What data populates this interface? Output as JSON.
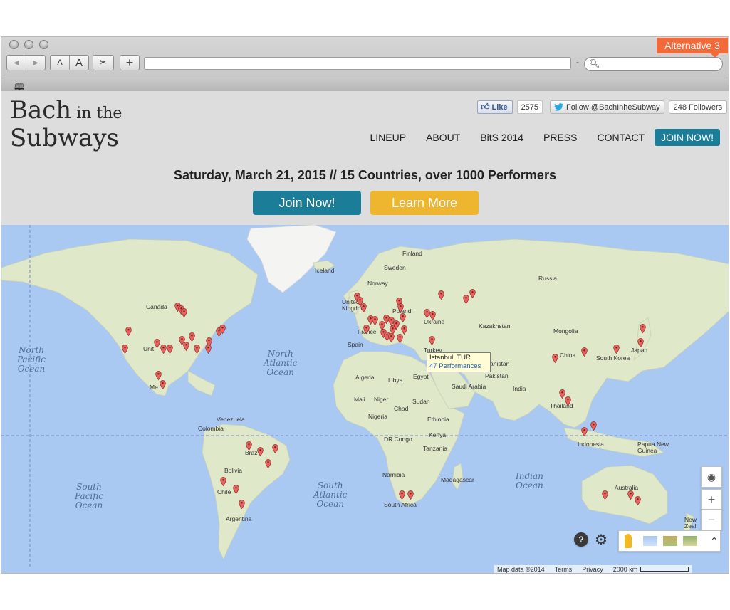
{
  "browser": {
    "nav_back": "◀",
    "nav_forward": "▶",
    "text_smaller": "A",
    "text_larger": "A",
    "scissors": "✂",
    "add_tab": "+",
    "url_separator": "-",
    "search_glyph": "🔍︎",
    "badge": "Alternative 3",
    "bookmarks_glyph": "🕮"
  },
  "site": {
    "logo_line1": "Bach",
    "logo_line1_small": " in the",
    "logo_line2": "Subways",
    "fb_like": "Like",
    "fb_count": "2575",
    "tw_follow": "Follow @BachInheSubway",
    "tw_count": "248 Followers",
    "nav": {
      "lineup": "LINEUP",
      "about": "ABOUT",
      "bits": "BitS 2014",
      "press": "PRESS",
      "contact": "CONTACT",
      "join": "JOIN NOW!"
    },
    "tagline": "Saturday, March 21, 2015 // 15 Countries, over 1000 Performers",
    "cta_join": "Join Now!",
    "cta_learn": "Learn More"
  },
  "map": {
    "oceans": {
      "north_pacific": "North\nPacific\nOcean",
      "north_atlantic": "North\nAtlantic\nOcean",
      "south_pacific": "South\nPacific\nOcean",
      "south_atlantic": "South\nAtlantic\nOcean",
      "indian": "Indian\nOcean"
    },
    "countries": {
      "finland": "Finland",
      "iceland": "Iceland",
      "sweden": "Sweden",
      "norway": "Norway",
      "russia": "Russia",
      "canada": "Canada",
      "united_kingdom": "United\nKingdom",
      "poland": "Poland",
      "ukraine": "Ukraine",
      "kazakhstan": "Kazakhstan",
      "mongolia": "Mongolia",
      "france": "France",
      "spain": "Spain",
      "turkey": "Turkey",
      "china": "China",
      "south_korea": "South Korea",
      "japan": "Japan",
      "united_states": "Unit",
      "algeria": "Algeria",
      "libya": "Libya",
      "egypt": "Egypt",
      "saudi_arabia": "Saudi Arabia",
      "pakistan": "Pakistan",
      "afghanistan": "anistan",
      "india": "India",
      "mexico": "Me",
      "mali": "Mali",
      "niger": "Niger",
      "chad": "Chad",
      "sudan": "Sudan",
      "nigeria": "Nigeria",
      "ethiopia": "Ethiopia",
      "thailand": "Thailand",
      "venezuela": "Venezuela",
      "colombia": "Colombia",
      "kenya": "Kenya",
      "dr_congo": "DR Congo",
      "tanzania": "Tanzania",
      "indonesia": "Indonesia",
      "papua": "Papua New\nGuinea",
      "brazil": "Braz",
      "bolivia": "Bolivia",
      "namibia": "Namibia",
      "madagascar": "Madagascar",
      "chile": "Chile",
      "argentina": "Argentina",
      "south_africa": "South Africa",
      "australia": "Australia",
      "new_zealand": "New\nZeal"
    },
    "infowindow": {
      "title": "Istanbul, TUR",
      "link": "47 Performances"
    },
    "controls": {
      "locate": "◉",
      "zoom_in": "+",
      "zoom_out": "−",
      "help": "?",
      "settings": "⚙",
      "expand": "⌃"
    },
    "footer": {
      "data": "Map data ©2014",
      "terms": "Terms",
      "privacy": "Privacy",
      "scale": "2000 km"
    },
    "colors": {
      "water": "#a9c8f2",
      "land": "#dfe8c9",
      "pin": "#e8625e",
      "accent": "#1c7d99",
      "accent2": "#eeb62f"
    }
  }
}
